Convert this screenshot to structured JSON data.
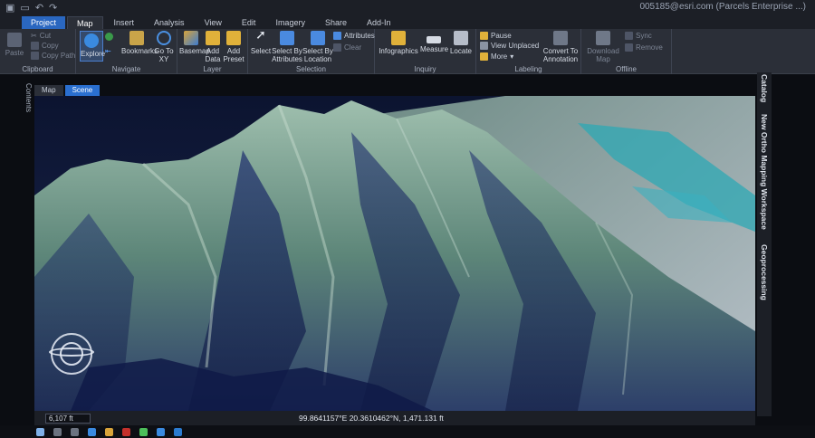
{
  "account": "005185@esri.com (Parcels Enterprise ...)",
  "tabs": [
    "Project",
    "Map",
    "Insert",
    "Analysis",
    "View",
    "Edit",
    "Imagery",
    "Share",
    "Add-In"
  ],
  "clipboard": {
    "paste": "Paste",
    "cut": "Cut",
    "copy": "Copy",
    "copy_path": "Copy Path",
    "label": "Clipboard"
  },
  "navigate": {
    "explore": "Explore",
    "bookmarks": "Bookmarks",
    "go_to_xy": "Go To XY",
    "label": "Navigate"
  },
  "layer": {
    "basemap": "Basemap",
    "add_data": "Add Data",
    "add_preset": "Add Preset",
    "label": "Layer"
  },
  "selection": {
    "select": "Select",
    "select_by_attributes": "Select By Attributes",
    "select_by_location": "Select By Location",
    "attributes": "Attributes",
    "clear": "Clear",
    "label": "Selection"
  },
  "inquiry": {
    "infographics": "Infographics",
    "measure": "Measure",
    "locate": "Locate",
    "label": "Inquiry"
  },
  "labeling": {
    "pause": "Pause",
    "view_unplaced": "View Unplaced",
    "more": "More",
    "convert": "Convert To Annotation",
    "label": "Labeling"
  },
  "offline": {
    "download_map": "Download Map",
    "sync": "Sync",
    "remove": "Remove",
    "label": "Offline"
  },
  "view_tabs": [
    "Map",
    "Scene"
  ],
  "contents_label": "Contents",
  "right_panes": [
    "Catalog",
    "New Ortho Mapping Workspace",
    "Geoprocessing"
  ],
  "status": {
    "scale": "6,107 ft",
    "coordinates": "99.8641157°E 20.3610462°N",
    "elevation": "1,471.131 ft"
  },
  "colors": {
    "project_tab": "#2a67c0",
    "ribbon": "#2b2f38",
    "accent": "#2a6fd0"
  }
}
